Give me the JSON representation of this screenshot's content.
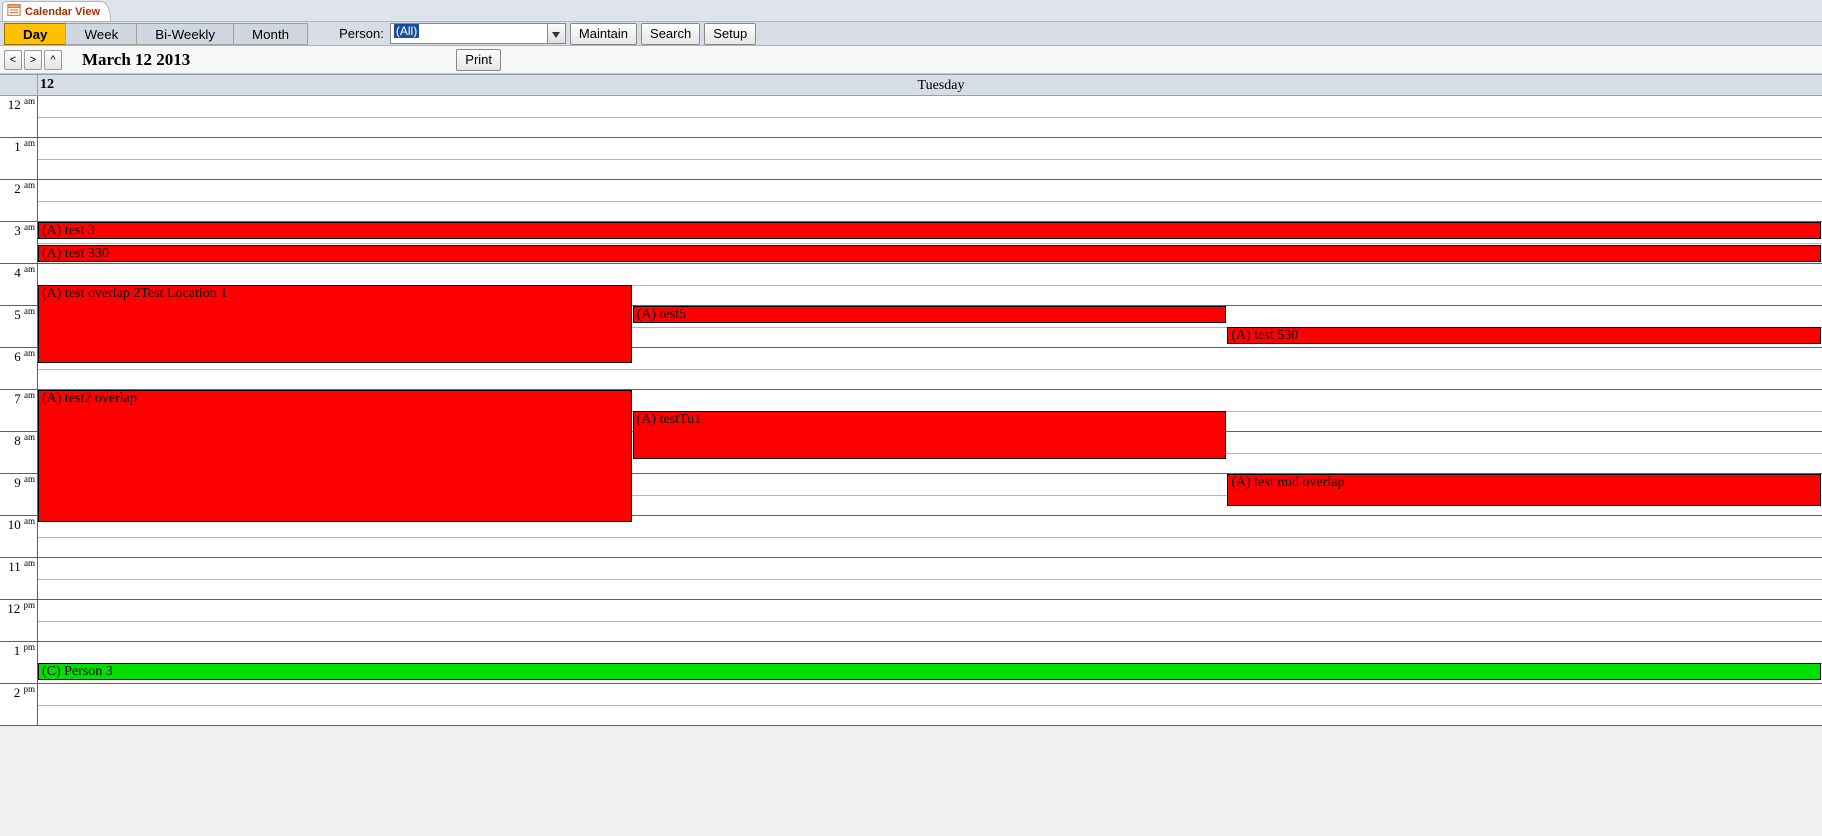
{
  "tab": {
    "title": "Calendar View"
  },
  "views": {
    "day": "Day",
    "week": "Week",
    "biweekly": "Bi-Weekly",
    "month": "Month",
    "active": "day"
  },
  "person": {
    "label": "Person:",
    "value": "(All)"
  },
  "buttons": {
    "maintain": "Maintain",
    "search": "Search",
    "setup": "Setup",
    "print": "Print"
  },
  "nav": {
    "prev": "<",
    "next": ">",
    "today": "^"
  },
  "date": {
    "title": "March 12 2013",
    "dayNum": "12",
    "dayName": "Tuesday"
  },
  "timeRows": [
    {
      "h": "12",
      "ap": "am"
    },
    {
      "h": "1",
      "ap": "am"
    },
    {
      "h": "2",
      "ap": "am"
    },
    {
      "h": "3",
      "ap": "am"
    },
    {
      "h": "4",
      "ap": "am"
    },
    {
      "h": "5",
      "ap": "am"
    },
    {
      "h": "6",
      "ap": "am"
    },
    {
      "h": "7",
      "ap": "am"
    },
    {
      "h": "8",
      "ap": "am"
    },
    {
      "h": "9",
      "ap": "am"
    },
    {
      "h": "10",
      "ap": "am"
    },
    {
      "h": "11",
      "ap": "am"
    },
    {
      "h": "12",
      "ap": "pm"
    },
    {
      "h": "1",
      "ap": "pm"
    },
    {
      "h": "2",
      "ap": "pm"
    }
  ],
  "events": [
    {
      "label": "(A) test 3",
      "color": "red",
      "startHour": 3.0,
      "endHour": 3.4,
      "col": 0,
      "colSpan": 3
    },
    {
      "label": "(A) test 330",
      "color": "red",
      "startHour": 3.55,
      "endHour": 3.95,
      "col": 0,
      "colSpan": 3
    },
    {
      "label": "(A) test overlap 2Test Location 1",
      "color": "red",
      "startHour": 4.5,
      "endHour": 6.35,
      "col": 0,
      "colSpan": 1
    },
    {
      "label": "(A) test5",
      "color": "red",
      "startHour": 5.0,
      "endHour": 5.4,
      "col": 1,
      "colSpan": 1
    },
    {
      "label": "(A) test 530",
      "color": "red",
      "startHour": 5.5,
      "endHour": 5.9,
      "col": 2,
      "colSpan": 1
    },
    {
      "label": "(A) test2 overlap",
      "color": "red",
      "startHour": 7.0,
      "endHour": 10.15,
      "col": 0,
      "colSpan": 1
    },
    {
      "label": "(A) testTu1",
      "color": "red",
      "startHour": 7.5,
      "endHour": 8.65,
      "col": 1,
      "colSpan": 1
    },
    {
      "label": "(A) test mid overlap",
      "color": "red",
      "startHour": 9.0,
      "endHour": 9.75,
      "col": 2,
      "colSpan": 1
    },
    {
      "label": "(C) Person 3",
      "color": "green",
      "startHour": 13.5,
      "endHour": 13.9,
      "col": 0,
      "colSpan": 3
    }
  ],
  "layout": {
    "hourPx": 42,
    "cols": 3
  }
}
